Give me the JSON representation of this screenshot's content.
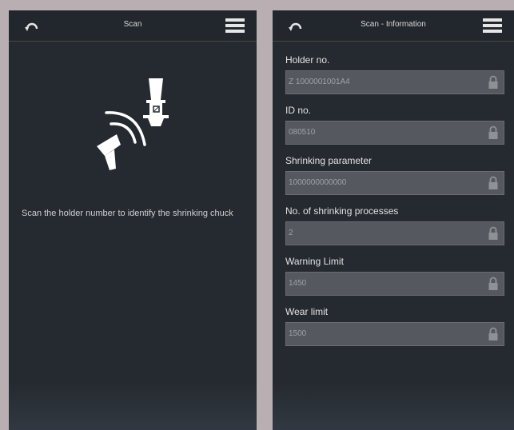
{
  "left_screen": {
    "title": "Scan",
    "instruction": "Scan the holder number to identify the shrinking chuck",
    "icons": [
      "back-icon",
      "menu-icon",
      "tool-holder-icon",
      "barcode-scanner-icon"
    ]
  },
  "right_screen": {
    "title": "Scan - Information",
    "fields": [
      {
        "label": "Holder no.",
        "value": "Z 1000001001A4"
      },
      {
        "label": "ID no.",
        "value": "080510"
      },
      {
        "label": "Shrinking parameter",
        "value": "1000000000000"
      },
      {
        "label": "No. of shrinking processes",
        "value": "2"
      },
      {
        "label": "Warning Limit",
        "value": "1450"
      },
      {
        "label": "Wear limit",
        "value": "1500"
      }
    ],
    "icons": [
      "back-icon",
      "menu-icon",
      "lock-icon"
    ]
  },
  "colors": {
    "background": "#b9aeb1",
    "screen": "#252a30",
    "field": "#55595f",
    "text": "#e2e2e2"
  }
}
